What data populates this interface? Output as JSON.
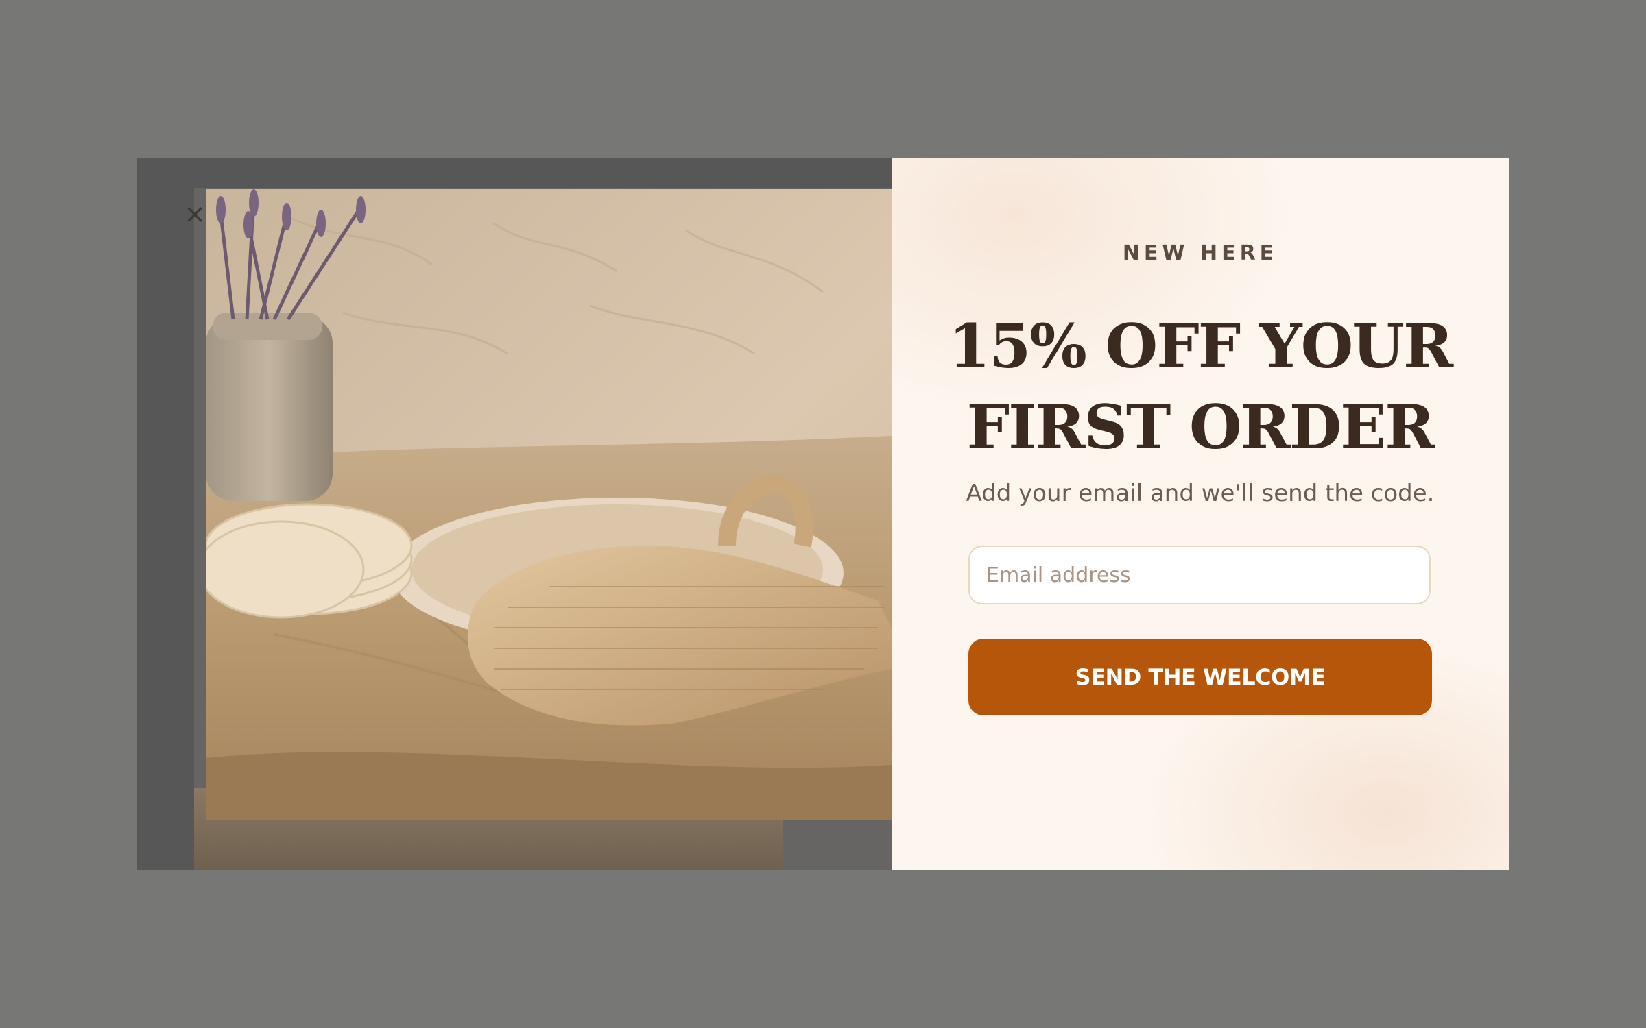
{
  "popup": {
    "close_glyph": "×",
    "eyebrow": "NEW HERE",
    "headline_line1": "15% OFF YOUR",
    "headline_line2": "FIRST ORDER",
    "subtext": "Add your email and we'll send the code.",
    "email_placeholder": "Email address",
    "email_value": "",
    "cta_label": "SEND THE WELCOME"
  },
  "colors": {
    "overlay": "#777776",
    "panel_bg": "#fdf6ef",
    "heading": "#3a2a1f",
    "cta_bg": "#b6560b",
    "cta_text": "#ffffff"
  }
}
